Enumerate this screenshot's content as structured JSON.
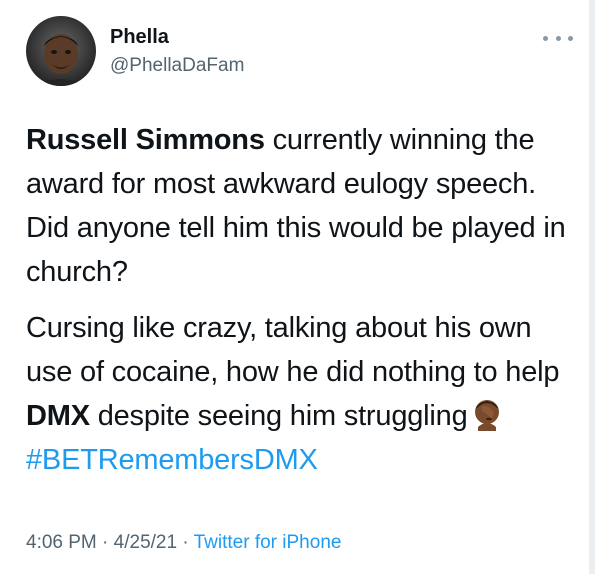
{
  "author": {
    "name": "Phella",
    "handle": "@PhellaDaFam"
  },
  "tweet": {
    "p1_mention": "Russell Simmons",
    "p1_text": " currently winning the award for most awkward eulogy speech. Did anyone tell him this would be played in church?",
    "p2_text_a": "Cursing like crazy, talking about his own use of cocaine, how he did nothing to help ",
    "p2_mention": "DMX",
    "p2_text_b": " despite seeing him struggling",
    "emoji": "person-facepalming-emoji",
    "hashtag": "#BETRemembersDMX"
  },
  "meta": {
    "time": "4:06 PM",
    "sep1": " · ",
    "date": "4/25/21",
    "sep2": " · ",
    "source": "Twitter for iPhone"
  },
  "colors": {
    "link": "#1d9bf0",
    "text": "#0f1419",
    "secondary": "#536471"
  }
}
